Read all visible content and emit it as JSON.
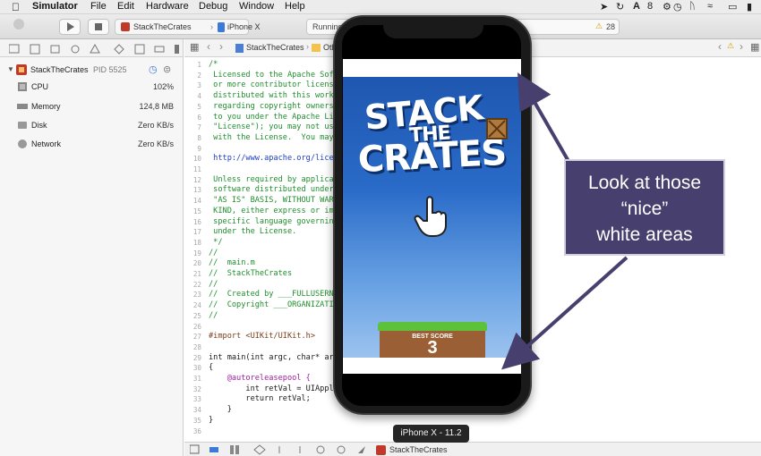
{
  "menubar": {
    "app": "Simulator",
    "items": [
      "File",
      "Edit",
      "Hardware",
      "Debug",
      "Window",
      "Help"
    ],
    "status_badge": "8"
  },
  "toolbar": {
    "scheme": "StackTheCrates",
    "destination": "iPhone X",
    "status": "Running",
    "warning_count": "28"
  },
  "navigator": {
    "process": "StackTheCrates",
    "pid": "PID 5525",
    "gauges": [
      {
        "label": "CPU",
        "value": "102%"
      },
      {
        "label": "Memory",
        "value": "124,8 MB"
      },
      {
        "label": "Disk",
        "value": "Zero KB/s"
      },
      {
        "label": "Network",
        "value": "Zero KB/s"
      }
    ]
  },
  "jumpbar": {
    "project": "StackTheCrates",
    "folder": "Oth"
  },
  "editor": {
    "lines": [
      {
        "n": "1",
        "text": "/*",
        "type": "comment"
      },
      {
        "n": "2",
        "text": " Licensed to the Apache Sof",
        "type": "comment"
      },
      {
        "n": "3",
        "text": " or more contributor license",
        "type": "comment"
      },
      {
        "n": "4",
        "text": " distributed with this work",
        "type": "comment"
      },
      {
        "n": "5",
        "text": " regarding copyright ownersh",
        "type": "comment"
      },
      {
        "n": "6",
        "text": " to you under the Apache Lic",
        "type": "comment"
      },
      {
        "n": "7",
        "text": " \"License\"); you may not us",
        "type": "comment"
      },
      {
        "n": "8",
        "text": " with the License.  You may",
        "type": "comment"
      },
      {
        "n": "9",
        "text": "",
        "type": "comment"
      },
      {
        "n": "10",
        "text": " http://www.apache.org/licen",
        "type": "link"
      },
      {
        "n": "11",
        "text": "",
        "type": "comment"
      },
      {
        "n": "12",
        "text": " Unless required by applicab",
        "type": "comment"
      },
      {
        "n": "13",
        "text": " software distributed under",
        "type": "comment"
      },
      {
        "n": "14",
        "text": " \"AS IS\" BASIS, WITHOUT WARR",
        "type": "comment"
      },
      {
        "n": "15",
        "text": " KIND, either express or imp",
        "type": "comment"
      },
      {
        "n": "16",
        "text": " specific language governing",
        "type": "comment"
      },
      {
        "n": "17",
        "text": " under the License.",
        "type": "comment"
      },
      {
        "n": "18",
        "text": " */",
        "type": "comment"
      },
      {
        "n": "19",
        "text": "//",
        "type": "comment"
      },
      {
        "n": "20",
        "text": "//  main.m",
        "type": "comment"
      },
      {
        "n": "21",
        "text": "//  StackTheCrates",
        "type": "comment"
      },
      {
        "n": "22",
        "text": "//",
        "type": "comment"
      },
      {
        "n": "23",
        "text": "//  Created by ___FULLUSERNA",
        "type": "comment"
      },
      {
        "n": "24",
        "text": "//  Copyright ___ORGANIZATIO",
        "type": "comment"
      },
      {
        "n": "25",
        "text": "//",
        "type": "comment"
      },
      {
        "n": "26",
        "text": "",
        "type": "plain"
      },
      {
        "n": "27",
        "text": "#import <UIKit/UIKit.h>",
        "type": "pre"
      },
      {
        "n": "28",
        "text": "",
        "type": "plain"
      },
      {
        "n": "29",
        "text": "int main(int argc, char* arg",
        "type": "plain"
      },
      {
        "n": "30",
        "text": "{",
        "type": "plain"
      },
      {
        "n": "31",
        "text": "    @autoreleasepool {",
        "type": "kw"
      },
      {
        "n": "32",
        "text": "        int retVal = UIAppli",
        "type": "plain"
      },
      {
        "n": "33",
        "text": "        return retVal;",
        "type": "plain"
      },
      {
        "n": "34",
        "text": "    }",
        "type": "plain"
      },
      {
        "n": "35",
        "text": "}",
        "type": "plain"
      },
      {
        "n": "36",
        "text": "",
        "type": "plain"
      }
    ]
  },
  "debugbar": {
    "target": "StackTheCrates"
  },
  "game": {
    "title_line1": "STACK",
    "title_line2": "THE",
    "title_line3": "CRATES",
    "best_score_label": "BEST SCORE",
    "best_score": "3"
  },
  "device_label": "iPhone X - 11.2",
  "callout": {
    "line1": "Look at those",
    "line2": "“nice”",
    "line3": "white areas"
  },
  "colors": {
    "callout_bg": "#473f6d",
    "arrow": "#473f6d",
    "comment": "#1f8f2d",
    "link": "#2040c8",
    "sky_top": "#1e57b0",
    "sky_bottom": "#9cc3ef"
  }
}
